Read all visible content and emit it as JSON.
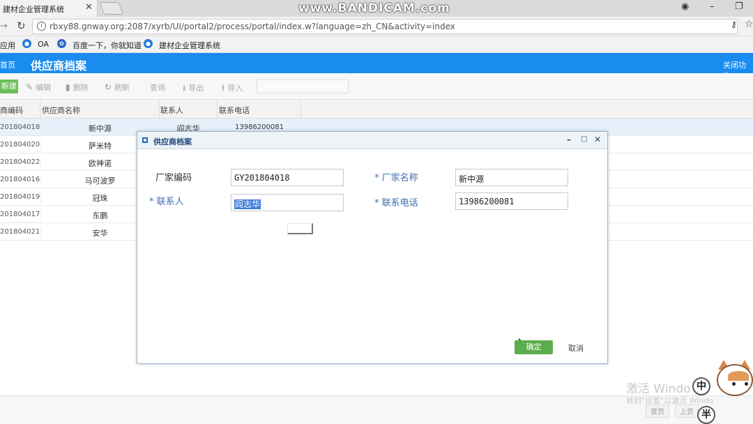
{
  "browser": {
    "tab_title": "建材企业管理系统",
    "tab_close": "✕",
    "watermark": "www.BANDICAM.com",
    "url": "rbxy88.gnway.org:2087/xyrb/UI/portal2/process/portal/index.w?language=zh_CN&activity=index",
    "bookmarks": [
      "应用",
      "OA",
      "百度一下，你就知道",
      "建材企业管理系统"
    ]
  },
  "app": {
    "home_link": "首页",
    "title": "供应商档案",
    "close_function": "关闭功能"
  },
  "toolbar": {
    "new_label": "新建",
    "edit_label": "编辑",
    "delete_label": "删除",
    "refresh_label": "刷新",
    "query_label": "查询",
    "export_label": "导出",
    "import_label": "导入"
  },
  "grid": {
    "headers": [
      "商编码",
      "供应商名称",
      "联系人",
      "联系电话"
    ],
    "rows": [
      {
        "code": "201804018",
        "name": "新中源",
        "contact": "阎志华",
        "phone": "13986200081"
      },
      {
        "code": "201804020",
        "name": "萨米特",
        "contact": "",
        "phone": ""
      },
      {
        "code": "201804022",
        "name": "欧神诺",
        "contact": "",
        "phone": ""
      },
      {
        "code": "201804016",
        "name": "马可波罗",
        "contact": "",
        "phone": ""
      },
      {
        "code": "201804019",
        "name": "冠珠",
        "contact": "",
        "phone": ""
      },
      {
        "code": "201804017",
        "name": "东鹏",
        "contact": "",
        "phone": ""
      },
      {
        "code": "201804021",
        "name": "安华",
        "contact": "",
        "phone": ""
      }
    ],
    "pager": {
      "first": "首页",
      "prev": "上页"
    }
  },
  "dialog": {
    "title": "供应商档案",
    "minimize": "–",
    "maximize": "□",
    "close": "✕",
    "fields": {
      "vendor_code_label": "厂家编码",
      "vendor_code_value": "GY201804018",
      "vendor_name_label": "* 厂家名称",
      "vendor_name_value": "新中源",
      "contact_label": "* 联系人",
      "contact_value": "阎志华",
      "phone_label": "* 联系电话",
      "phone_value": "13986200081"
    },
    "ok_label": "确定",
    "cancel_label": "取消"
  },
  "overlay": {
    "activate_line1": "激活 Windo",
    "activate_line2": "转到\"设置\"以激活 Windo",
    "bubble_top": "中",
    "bubble_bottom": "半"
  },
  "colors": {
    "header_blue": "#1a8cf0",
    "ok_green": "#5cad4c",
    "new_green": "#6cbf5a",
    "selection_blue": "#3b7ddb"
  }
}
